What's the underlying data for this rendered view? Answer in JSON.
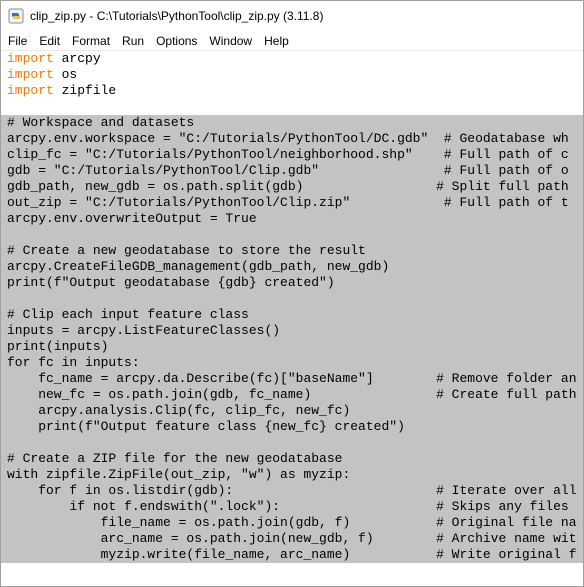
{
  "window": {
    "title": "clip_zip.py - C:\\Tutorials\\PythonTool\\clip_zip.py (3.11.8)"
  },
  "menu": {
    "items": [
      "File",
      "Edit",
      "Format",
      "Run",
      "Options",
      "Window",
      "Help"
    ]
  },
  "editor": {
    "imports": [
      {
        "keyword": "import",
        "module": " arcpy"
      },
      {
        "keyword": "import",
        "module": " os"
      },
      {
        "keyword": "import",
        "module": " zipfile"
      }
    ],
    "selected_lines": [
      "# Workspace and datasets",
      "arcpy.env.workspace = \"C:/Tutorials/PythonTool/DC.gdb\"  # Geodatabase wh",
      "clip_fc = \"C:/Tutorials/PythonTool/neighborhood.shp\"    # Full path of c",
      "gdb = \"C:/Tutorials/PythonTool/Clip.gdb\"                # Full path of o",
      "gdb_path, new_gdb = os.path.split(gdb)                 # Split full path",
      "out_zip = \"C:/Tutorials/PythonTool/Clip.zip\"            # Full path of t",
      "arcpy.env.overwriteOutput = True",
      "",
      "# Create a new geodatabase to store the result",
      "arcpy.CreateFileGDB_management(gdb_path, new_gdb)",
      "print(f\"Output geodatabase {gdb} created\")",
      "",
      "# Clip each input feature class",
      "inputs = arcpy.ListFeatureClasses()",
      "print(inputs)",
      "for fc in inputs:",
      "    fc_name = arcpy.da.Describe(fc)[\"baseName\"]        # Remove folder an",
      "    new_fc = os.path.join(gdb, fc_name)                # Create full path",
      "    arcpy.analysis.Clip(fc, clip_fc, new_fc)",
      "    print(f\"Output feature class {new_fc} created\")",
      "",
      "# Create a ZIP file for the new geodatabase",
      "with zipfile.ZipFile(out_zip, \"w\") as myzip:",
      "    for f in os.listdir(gdb):                          # Iterate over all",
      "        if not f.endswith(\".lock\"):                    # Skips any files",
      "            file_name = os.path.join(gdb, f)           # Original file na",
      "            arc_name = os.path.join(new_gdb, f)        # Archive name wit",
      "            myzip.write(file_name, arc_name)           # Write original f"
    ]
  }
}
